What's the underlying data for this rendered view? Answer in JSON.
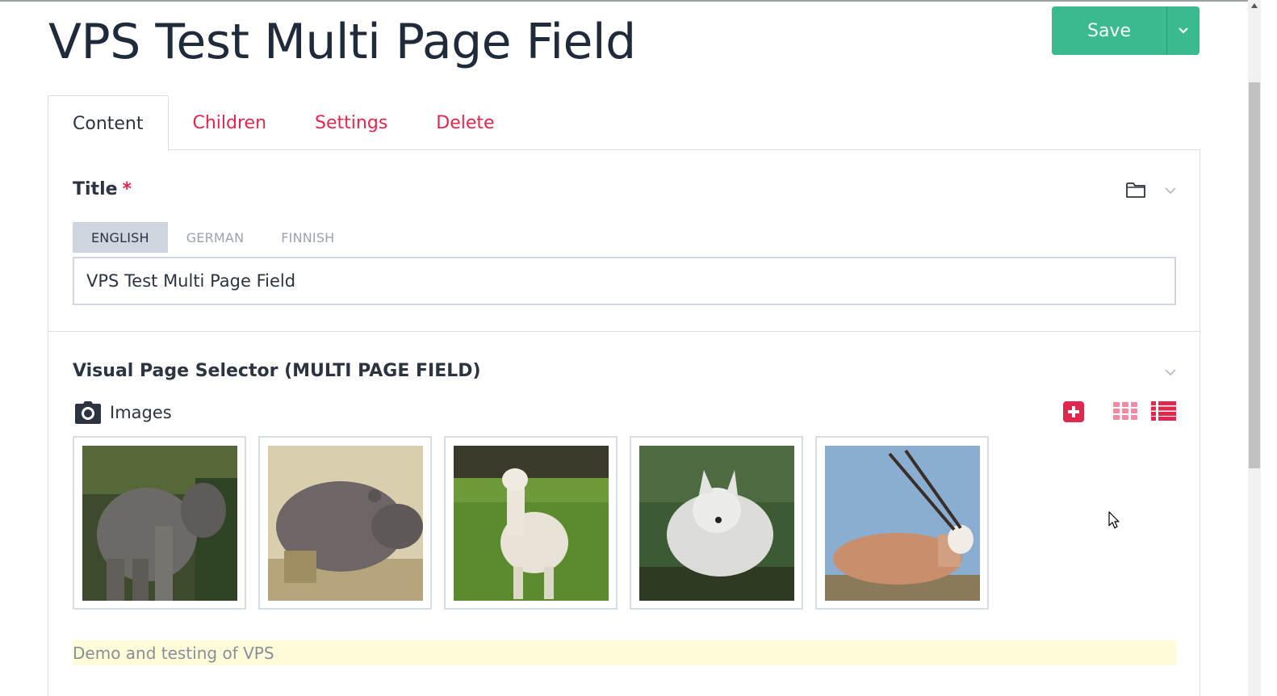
{
  "page": {
    "title": "VPS Test Multi Page Field"
  },
  "toolbar": {
    "save_label": "Save"
  },
  "tabs": [
    {
      "label": "Content",
      "active": true
    },
    {
      "label": "Children",
      "active": false
    },
    {
      "label": "Settings",
      "active": false
    },
    {
      "label": "Delete",
      "active": false
    }
  ],
  "title_field": {
    "label": "Title",
    "required_marker": "*",
    "languages": [
      {
        "label": "ENGLISH",
        "active": true
      },
      {
        "label": "GERMAN",
        "active": false
      },
      {
        "label": "FINNISH",
        "active": false
      }
    ],
    "value": "VPS Test Multi Page Field"
  },
  "vps_field": {
    "label": "Visual Page Selector (MULTI PAGE FIELD)",
    "images_label": "Images",
    "images": [
      {
        "icon": "elephant-image"
      },
      {
        "icon": "hippo-image"
      },
      {
        "icon": "alpaca-image"
      },
      {
        "icon": "arctic-fox-image"
      },
      {
        "icon": "oryx-image"
      }
    ],
    "description": "Demo and testing of VPS"
  },
  "colors": {
    "accent": "#e0284f",
    "save": "#3bb98f",
    "lang_active": "#cfd6e0",
    "description_bg": "#fefbd8"
  }
}
